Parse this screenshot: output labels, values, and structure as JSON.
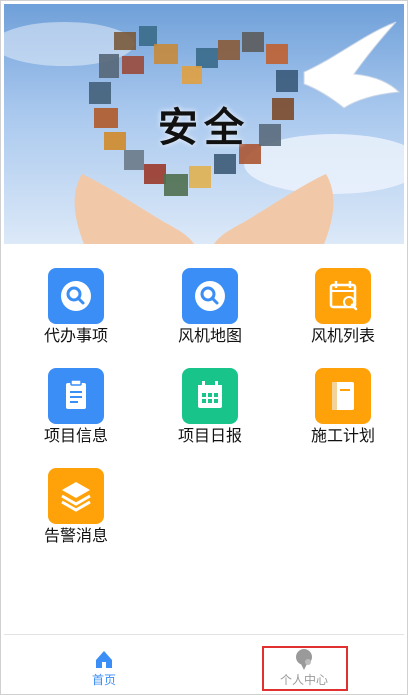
{
  "banner": {
    "title": "安全"
  },
  "colors": {
    "blue": "#3a8ef6",
    "green": "#18c48a",
    "orange": "#ffa20a",
    "tab_active": "#3a8ef6",
    "tab_inactive": "#9a9a9a"
  },
  "menu": [
    {
      "label": "代办事项",
      "icon": "search-icon",
      "color": "blue"
    },
    {
      "label": "风机地图",
      "icon": "search-icon",
      "color": "blue"
    },
    {
      "label": "风机列表",
      "icon": "calendar-search-icon",
      "color": "orange"
    },
    {
      "label": "项目信息",
      "icon": "clipboard-icon",
      "color": "blue"
    },
    {
      "label": "项目日报",
      "icon": "calendar-icon",
      "color": "green"
    },
    {
      "label": "施工计划",
      "icon": "book-icon",
      "color": "orange"
    },
    {
      "label": "告警消息",
      "icon": "layers-icon",
      "color": "orange"
    }
  ],
  "tabs": [
    {
      "label": "首页",
      "icon": "home-icon",
      "active": true
    },
    {
      "label": "个人中心",
      "icon": "user-chat-icon",
      "active": false
    }
  ]
}
